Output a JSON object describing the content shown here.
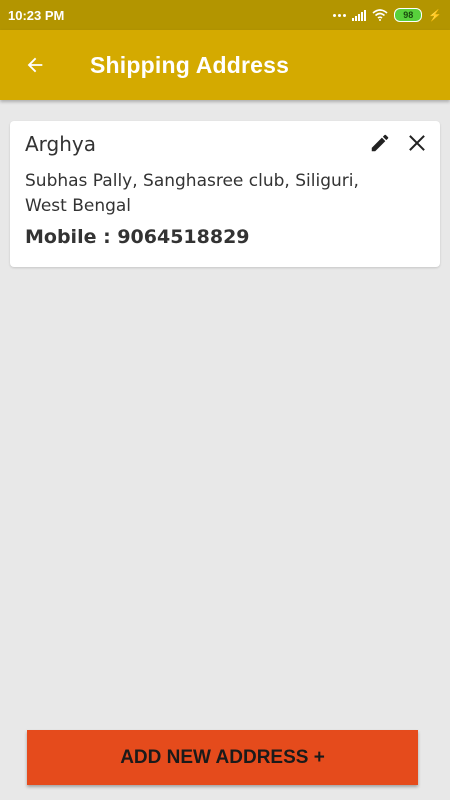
{
  "status_bar": {
    "time": "10:23 PM",
    "battery": "98"
  },
  "header": {
    "title": "Shipping Address",
    "back_icon": "arrow-left-icon"
  },
  "address_card": {
    "name": "Arghya",
    "address": "Subhas Pally, Sanghasree club, Siliguri, West Bengal",
    "mobile_label": "Mobile : ",
    "mobile_number": "9064518829",
    "edit_icon": "pencil-icon",
    "delete_icon": "close-icon"
  },
  "footer": {
    "add_button_label": "ADD NEW ADDRESS +"
  },
  "colors": {
    "status_bar": "#b39500",
    "app_bar": "#d4aa00",
    "add_button": "#e54b1c",
    "background": "#e8e8e8"
  }
}
